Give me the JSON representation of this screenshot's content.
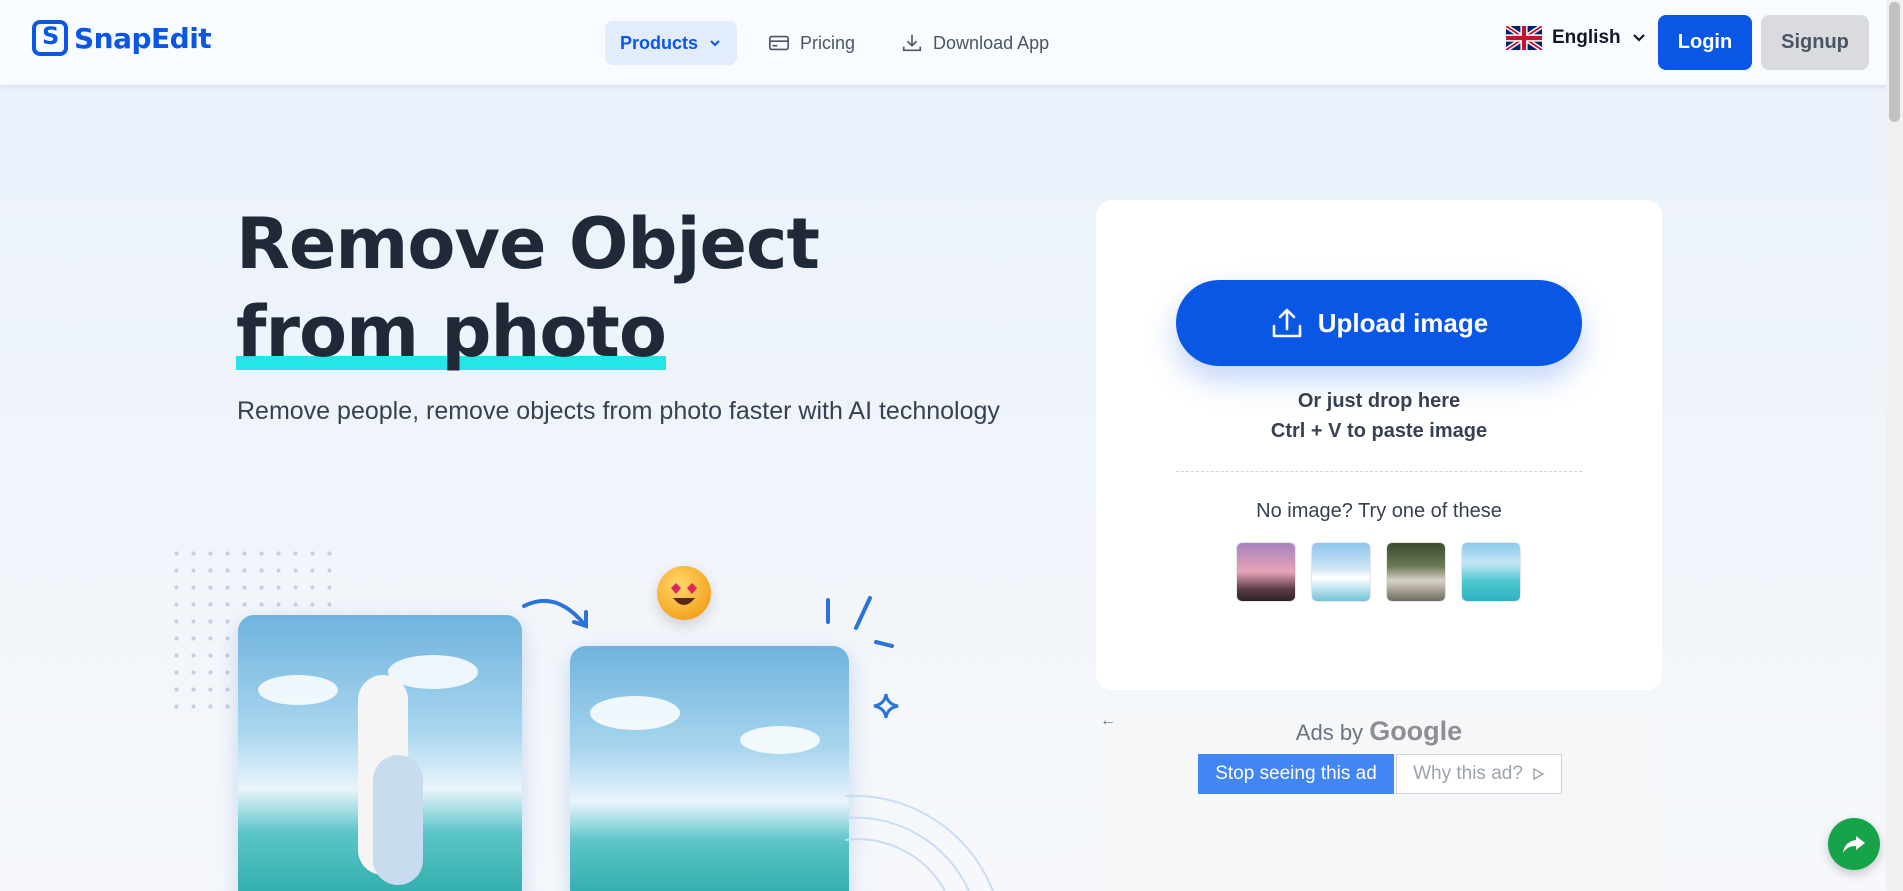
{
  "brand": {
    "name": "SnapEdit",
    "color": "#0a57e6"
  },
  "nav": {
    "products": "Products",
    "pricing": "Pricing",
    "download": "Download App"
  },
  "header": {
    "language": "English",
    "login": "Login",
    "signup": "Signup"
  },
  "hero": {
    "title_line1": "Remove Object",
    "title_line2": "from photo",
    "subtitle": "Remove people, remove objects from photo faster with AI technology"
  },
  "upload": {
    "button": "Upload image",
    "drop_hint": "Or just drop here",
    "paste_hint": "Ctrl + V to paste image",
    "try_text": "No image? Try one of these",
    "samples": [
      "sample-balloons",
      "sample-beach-couple",
      "sample-people-park",
      "sample-sea"
    ]
  },
  "ad": {
    "ads_by": "Ads by",
    "google": "Google",
    "stop": "Stop seeing this ad",
    "why": "Why this ad?"
  },
  "icons": {
    "chevron": "chevron-down-icon",
    "pricing": "credit-card-icon",
    "download": "download-icon",
    "upload": "upload-icon",
    "share": "share-icon"
  }
}
